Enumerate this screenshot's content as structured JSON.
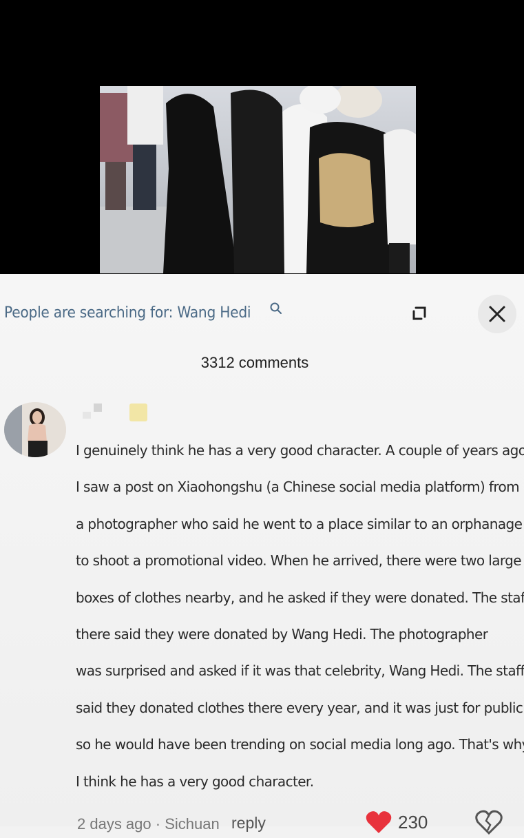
{
  "search": {
    "label": "People are searching for: Wang Hedi",
    "icon": "search-icon"
  },
  "toolbar": {
    "expand_icon": "expand-icon",
    "close_icon": "close-icon"
  },
  "comments_count": "3312 comments",
  "comment": {
    "lines": [
      "I genuinely think he has a very good character. A couple of years ago,",
      "I saw a post on Xiaohongshu (a Chinese social media platform) from",
      "a photographer who said he went to a place similar to an orphanage",
      "to shoot a promotional video. When he arrived, there were two large",
      "boxes of clothes nearby, and he asked if they were donated. The staff",
      "there said they were donated by Wang Hedi. The photographer",
      "was surprised and asked if it was that celebrity, Wang Hedi. The staff",
      "said they donated clothes there every year, and it was just for publicity,",
      "so he would have been trending on social media long ago. That's why",
      "I think he has a very good character."
    ],
    "meta": "2 days ago · Sichuan",
    "reply_label": "reply",
    "likes": "230"
  },
  "colors": {
    "like": "#e8323c",
    "search_text": "#4b6a86"
  }
}
